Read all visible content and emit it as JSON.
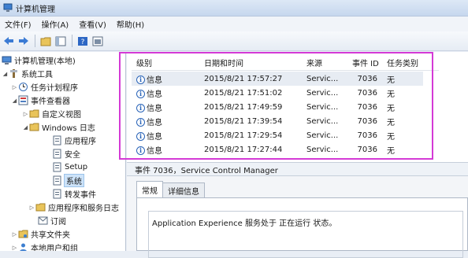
{
  "window": {
    "title": "计算机管理"
  },
  "menu": [
    "文件(F)",
    "操作(A)",
    "查看(V)",
    "帮助(H)"
  ],
  "toolbar": {
    "buttons": [
      "back-icon",
      "forward-icon",
      "folder-icon",
      "console-tree-icon",
      "help-icon",
      "panel-icon"
    ]
  },
  "tree": {
    "root": "计算机管理(本地)",
    "system_tools": "系统工具",
    "task_scheduler": "任务计划程序",
    "event_viewer": "事件查看器",
    "custom_views": "自定义视图",
    "windows_logs": "Windows 日志",
    "application": "应用程序",
    "security": "安全",
    "setup": "Setup",
    "system": "系统",
    "forwarded_events": "转发事件",
    "app_service_logs": "应用程序和服务日志",
    "subscriptions": "订阅",
    "shared_folders": "共享文件夹",
    "local_users": "本地用户和组"
  },
  "list": {
    "headers": {
      "level": "级别",
      "date": "日期和时间",
      "source": "来源",
      "event_id": "事件 ID",
      "category": "任务类别"
    },
    "rows": [
      {
        "level": "信息",
        "date": "2015/8/21 17:57:27",
        "source": "Servic...",
        "event_id": "7036",
        "category": "无"
      },
      {
        "level": "信息",
        "date": "2015/8/21 17:51:02",
        "source": "Servic...",
        "event_id": "7036",
        "category": "无"
      },
      {
        "level": "信息",
        "date": "2015/8/21 17:49:59",
        "source": "Servic...",
        "event_id": "7036",
        "category": "无"
      },
      {
        "level": "信息",
        "date": "2015/8/21 17:39:54",
        "source": "Servic...",
        "event_id": "7036",
        "category": "无"
      },
      {
        "level": "信息",
        "date": "2015/8/21 17:29:54",
        "source": "Servic...",
        "event_id": "7036",
        "category": "无"
      },
      {
        "level": "信息",
        "date": "2015/8/21 17:27:44",
        "source": "Servic...",
        "event_id": "7036",
        "category": "无"
      }
    ]
  },
  "detail": {
    "title": "事件 7036，Service Control Manager",
    "tabs": [
      "常规",
      "详细信息"
    ],
    "description": "Application Experience 服务处于 正在运行 状态。"
  },
  "colors": {
    "highlight_box": "#d43ad6",
    "info_icon": "#2a64b8"
  }
}
